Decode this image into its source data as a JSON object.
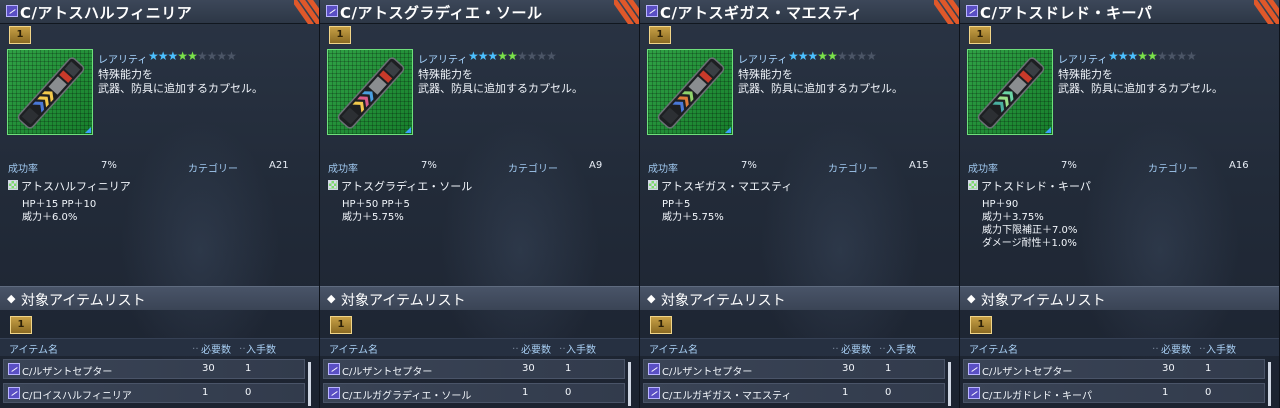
{
  "labels": {
    "rarity": "レアリティ",
    "success_rate": "成功率",
    "category": "カテゴリー",
    "item_list": "対象アイテムリスト",
    "col_item_name": "アイテム名",
    "col_required": "必要数",
    "col_obtained": "入手数"
  },
  "panels": [
    {
      "title": "C/アトスハルフィニリア",
      "badge": "1",
      "stars_lit": 5,
      "stars_total": 9,
      "desc1": "特殊能力を",
      "desc2": "武器、防具に追加するカプセル。",
      "success_rate": "7%",
      "category": "A21",
      "effect_name": "アトスハルフィニリア",
      "effects": [
        "HP＋15 PP＋10",
        "威力＋6.0%"
      ],
      "rows": [
        {
          "name": "C/ルザントセプター",
          "required": "30",
          "obtained": "1"
        },
        {
          "name": "C/ロイスハルフィニリア",
          "required": "1",
          "obtained": "0"
        }
      ]
    },
    {
      "title": "C/アトスグラディエ・ソール",
      "badge": "1",
      "stars_lit": 5,
      "stars_total": 9,
      "desc1": "特殊能力を",
      "desc2": "武器、防具に追加するカプセル。",
      "success_rate": "7%",
      "category": "A9",
      "effect_name": "アトスグラディエ・ソール",
      "effects": [
        "HP＋50 PP＋5",
        "威力＋5.75%"
      ],
      "rows": [
        {
          "name": "C/ルザントセプター",
          "required": "30",
          "obtained": "1"
        },
        {
          "name": "C/エルガグラディエ・ソール",
          "required": "1",
          "obtained": "0"
        }
      ]
    },
    {
      "title": "C/アトスギガス・マエスティ",
      "badge": "1",
      "stars_lit": 5,
      "stars_total": 9,
      "desc1": "特殊能力を",
      "desc2": "武器、防具に追加するカプセル。",
      "success_rate": "7%",
      "category": "A15",
      "effect_name": "アトスギガス・マエスティ",
      "effects": [
        "PP＋5",
        "威力＋5.75%"
      ],
      "rows": [
        {
          "name": "C/ルザントセプター",
          "required": "30",
          "obtained": "1"
        },
        {
          "name": "C/エルガギガス・マエスティ",
          "required": "1",
          "obtained": "0"
        }
      ]
    },
    {
      "title": "C/アトスドレド・キーパ",
      "badge": "1",
      "stars_lit": 5,
      "stars_total": 9,
      "desc1": "特殊能力を",
      "desc2": "武器、防具に追加するカプセル。",
      "success_rate": "7%",
      "category": "A16",
      "effect_name": "アトスドレド・キーパ",
      "effects": [
        "HP＋90",
        "威力＋3.75%",
        "威力下限補正＋7.0%",
        "ダメージ耐性＋1.0%"
      ],
      "rows": [
        {
          "name": "C/ルザントセプター",
          "required": "30",
          "obtained": "1"
        },
        {
          "name": "C/エルガドレド・キーパ",
          "required": "1",
          "obtained": "0"
        }
      ]
    }
  ]
}
